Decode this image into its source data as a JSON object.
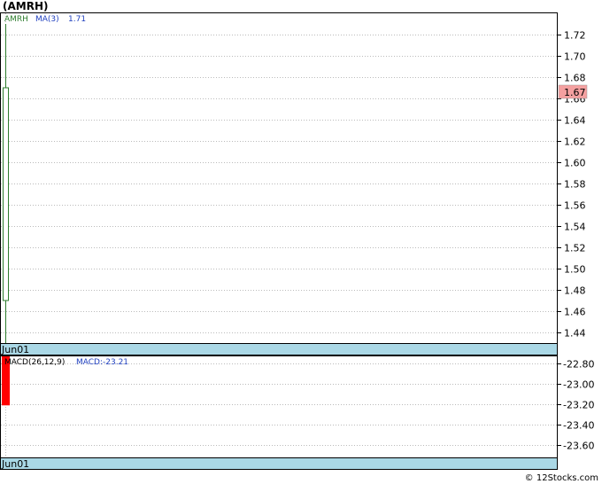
{
  "chart_data": [
    {
      "type": "candlestick",
      "title": "(AMRH)",
      "legend": {
        "ticker": "AMRH",
        "ma_label": "MA(3)",
        "ma_value": "1.71"
      },
      "x": [
        "Jun01"
      ],
      "ohlc": [
        {
          "date": "Jun01",
          "open": 1.67,
          "high": 1.73,
          "low": 1.43,
          "close": 1.47
        }
      ],
      "ylim": [
        1.43,
        1.74
      ],
      "yticks": [
        "1.72",
        "1.70",
        "1.68",
        "1.66",
        "1.64",
        "1.62",
        "1.60",
        "1.58",
        "1.56",
        "1.54",
        "1.52",
        "1.50",
        "1.48",
        "1.46",
        "1.44"
      ],
      "ytick_values": [
        1.72,
        1.7,
        1.68,
        1.66,
        1.64,
        1.62,
        1.6,
        1.58,
        1.56,
        1.54,
        1.52,
        1.5,
        1.48,
        1.46,
        1.44
      ],
      "last_price": "1.67",
      "last_price_color": "#f4a0a0",
      "grid": true,
      "x_label": "Jun01"
    },
    {
      "type": "bar",
      "title": "",
      "legend": {
        "label": "MACD(26,12,9)",
        "value_label": "MACD:-23.21"
      },
      "x": [
        "Jun01"
      ],
      "values": [
        -23.21
      ],
      "bar_top": -22.73,
      "ylim": [
        -23.72,
        -22.73
      ],
      "yticks": [
        "-22.80",
        "-23.00",
        "-23.20",
        "-23.40",
        "-23.60"
      ],
      "ytick_values": [
        -22.8,
        -23.0,
        -23.2,
        -23.4,
        -23.6
      ],
      "bar_color": "#ff0000",
      "grid": true,
      "x_label": "Jun01"
    }
  ],
  "footer": {
    "watermark": "© 12Stocks.com"
  },
  "colors": {
    "axis_band": "#aad8e6",
    "grid": "#bbbbbb",
    "candle": "#2e7d2e",
    "ma_text": "#1f3fbf"
  }
}
